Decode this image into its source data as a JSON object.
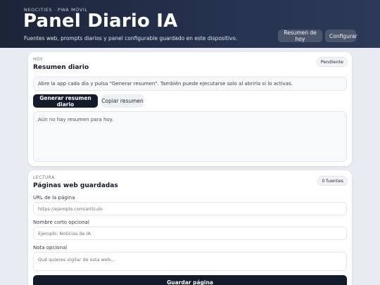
{
  "header": {
    "eyebrow": "NEOCITIES · PWA MÓVIL",
    "title": "Panel Diario IA",
    "subtitle": "Fuentes web, prompts diarios y panel configurable guardado en este dispositivo.",
    "summary_button": "Resumen de hoy",
    "config_button": "Configurar"
  },
  "daily": {
    "kicker": "HOY",
    "title": "Resumen diario",
    "status": "Pendiente",
    "info": "Abre la app cada día y pulsa \"Generar resumen\". También puede ejecutarse solo al abrirla si lo activas.",
    "generate_button": "Generar resumen diario",
    "copy_button": "Copiar resumen",
    "summary_text": "Aún no hay resumen para hoy."
  },
  "web": {
    "kicker": "LECTURA",
    "title": "Páginas web guardadas",
    "count": "0 fuentes",
    "url_label": "URL de la página",
    "url_placeholder": "https://ejemplo.com/articulo",
    "name_label": "Nombre corto opcional",
    "name_placeholder": "Ejemplo: Noticias de IA",
    "note_label": "Nota opcional",
    "note_placeholder": "Qué quieres vigilar de esta web...",
    "save_button": "Guardar página"
  }
}
